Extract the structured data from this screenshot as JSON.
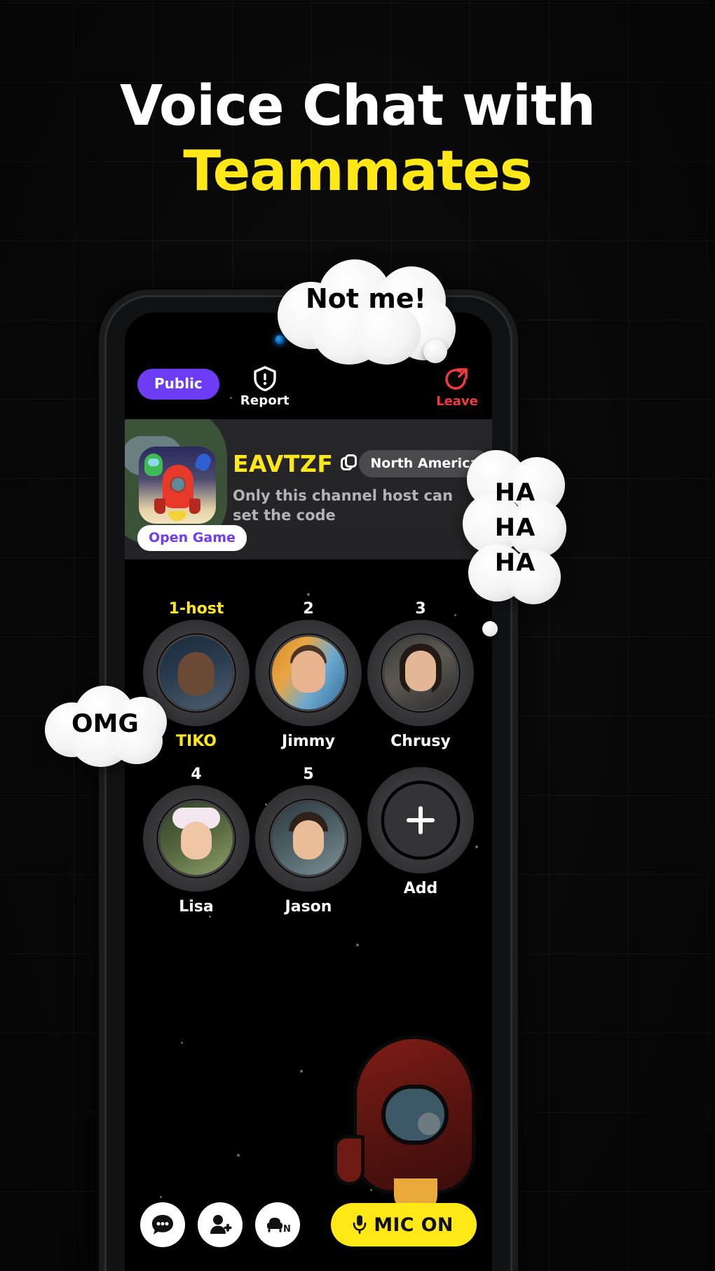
{
  "poster": {
    "headline_line1": "Voice Chat with",
    "headline_line2": "Teammates",
    "accent_yellow": "#ffe816",
    "accent_purple": "#6d3cf5",
    "background": "#0a0a0a"
  },
  "bubbles": [
    {
      "id": "not-me",
      "text": "Not me!"
    },
    {
      "id": "haha",
      "lines": [
        "HA",
        "HA",
        "HA"
      ]
    },
    {
      "id": "omg",
      "text": "OMG"
    }
  ],
  "app": {
    "topbar": {
      "privacy_badge": "Public",
      "report_label": "Report",
      "report_icon": "shield-exclamation-icon",
      "leave_label": "Leave",
      "leave_icon": "exit-arrow-icon",
      "leave_color": "#ef3b3b"
    },
    "game_card": {
      "thumbnail_icon": "rocket-game-icon",
      "open_game_label": "Open Game",
      "room_code": "EAVTZF",
      "copy_icon": "copy-icon",
      "region": "North America",
      "description": "Only this channel host can set the code"
    },
    "participants": [
      {
        "seat": "1-host",
        "name": "TIKO",
        "is_host": true
      },
      {
        "seat": "2",
        "name": "Jimmy",
        "is_host": false
      },
      {
        "seat": "3",
        "name": "Chrusy",
        "is_host": false
      },
      {
        "seat": "4",
        "name": "Lisa",
        "is_host": false
      },
      {
        "seat": "5",
        "name": "Jason",
        "is_host": false
      },
      {
        "seat": "",
        "name": "Add",
        "is_host": false,
        "is_add_button": true
      }
    ],
    "bottombar": {
      "chat_icon": "chat-bubble-icon",
      "invite_icon": "add-person-icon",
      "seat_icon": "sofa-n-icon",
      "mic_icon": "microphone-icon",
      "mic_label": "MIC ON",
      "mic_color": "#ffe816"
    }
  }
}
